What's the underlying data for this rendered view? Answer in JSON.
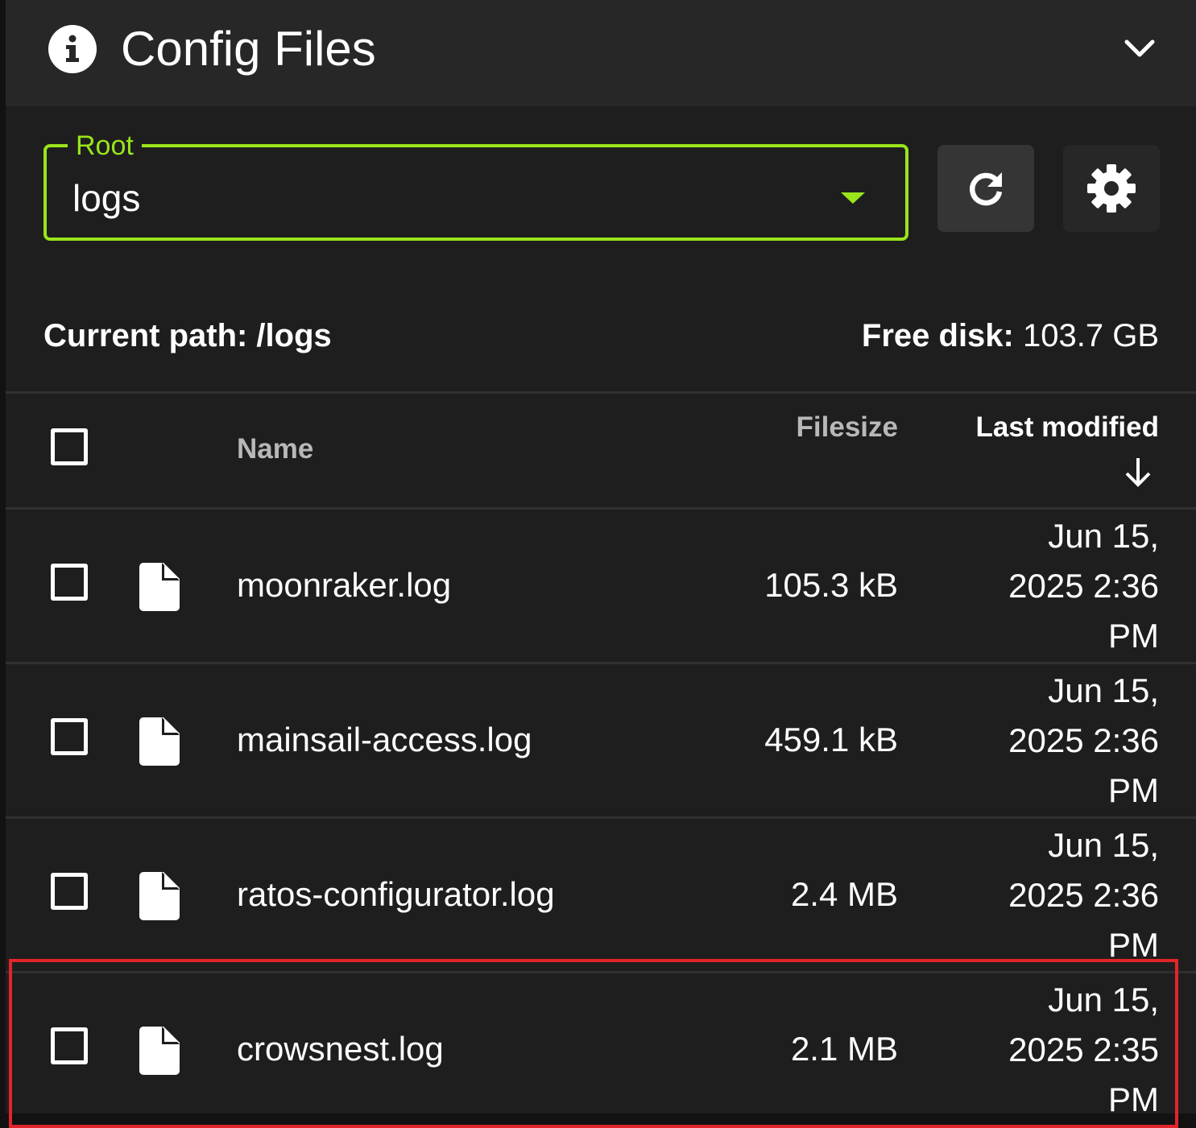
{
  "header": {
    "title": "Config Files",
    "info_icon": "info-icon",
    "collapse_icon": "chevron-down-icon"
  },
  "root_select": {
    "label": "Root",
    "value": "logs",
    "accent_color": "#9ae41b"
  },
  "toolbar": {
    "refresh_icon": "refresh-icon",
    "settings_icon": "gear-icon"
  },
  "path_info": {
    "current_path_label": "Current path: /logs",
    "free_disk_label": "Free disk:",
    "free_disk_value": " 103.7 GB"
  },
  "table": {
    "headers": {
      "name": "Name",
      "filesize": "Filesize",
      "last_modified": "Last modified"
    },
    "sort": {
      "column": "last_modified",
      "direction": "descending",
      "icon": "arrow-down-icon"
    },
    "rows": [
      {
        "name": "moonraker.log",
        "size": "105.3 kB",
        "date": "Jun 15, 2025 2:36 PM",
        "icon": "file-icon"
      },
      {
        "name": "mainsail-access.log",
        "size": "459.1 kB",
        "date": "Jun 15, 2025 2:36 PM",
        "icon": "file-icon"
      },
      {
        "name": "ratos-configurator.log",
        "size": "2.4 MB",
        "date": "Jun 15, 2025 2:36 PM",
        "icon": "file-icon"
      },
      {
        "name": "crowsnest.log",
        "size": "2.1 MB",
        "date": "Jun 15, 2025 2:35 PM",
        "icon": "file-icon"
      }
    ]
  },
  "highlight_color": "#e0252b"
}
